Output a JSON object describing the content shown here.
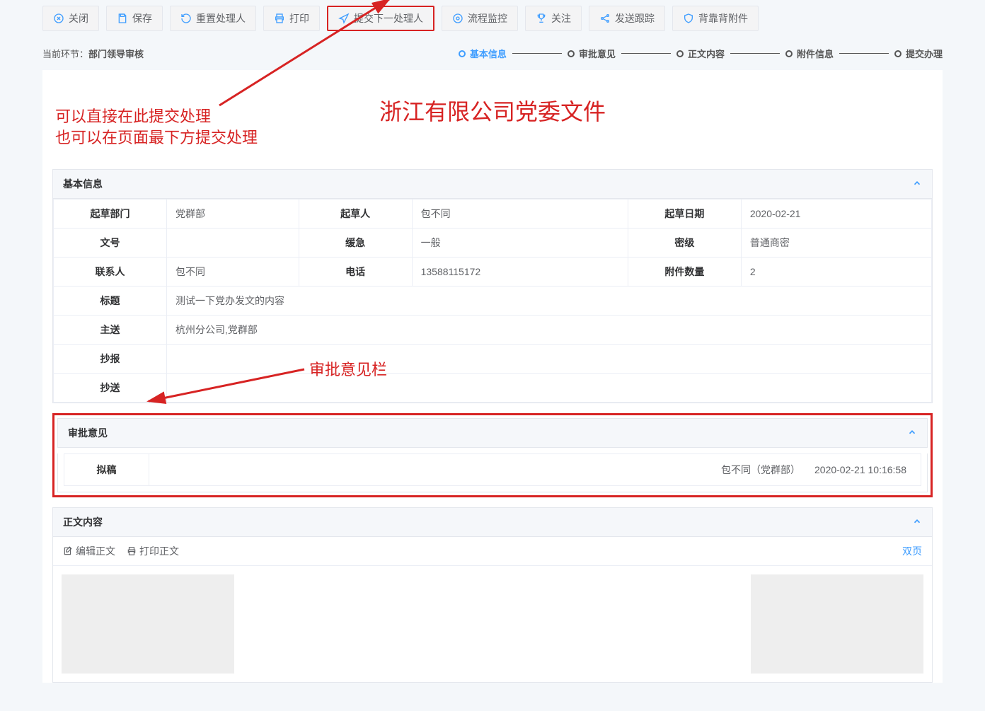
{
  "toolbar": {
    "close": "关闭",
    "save": "保存",
    "reset_handler": "重置处理人",
    "print": "打印",
    "submit_next": "提交下一处理人",
    "flow_monitor": "流程监控",
    "follow": "关注",
    "send_track": "发送跟踪",
    "back_to_back_attach": "背靠背附件"
  },
  "subheader": {
    "stage_label": "当前环节：",
    "stage_value": "部门领导审核"
  },
  "breadcrumb": [
    {
      "label": "基本信息",
      "active": true
    },
    {
      "label": "审批意见",
      "active": false
    },
    {
      "label": "正文内容",
      "active": false
    },
    {
      "label": "附件信息",
      "active": false
    },
    {
      "label": "提交办理",
      "active": false
    }
  ],
  "annotations": {
    "line1": "可以直接在此提交处理",
    "line2": "也可以在页面最下方提交处理",
    "approval_col": "审批意见栏"
  },
  "doc_title": "浙江有限公司党委文件",
  "panels": {
    "basic": {
      "title": "基本信息",
      "rows": {
        "dept_label": "起草部门",
        "dept_value": "党群部",
        "drafter_label": "起草人",
        "drafter_value": "包不同",
        "date_label": "起草日期",
        "date_value": "2020-02-21",
        "docno_label": "文号",
        "docno_value": "",
        "urgency_label": "缓急",
        "urgency_value": "一般",
        "secret_label": "密级",
        "secret_value": "普通商密",
        "contact_label": "联系人",
        "contact_value": "包不同",
        "phone_label": "电话",
        "phone_value": "13588115172",
        "attach_label": "附件数量",
        "attach_value": "2",
        "title_label": "标题",
        "title_value": "测试一下党办发文的内容",
        "mainsend_label": "主送",
        "mainsend_value": "杭州分公司,党群部",
        "cc_label": "抄报",
        "cc_value": "",
        "cc2_label": "抄送",
        "cc2_value": ""
      }
    },
    "approval": {
      "title": "审批意见",
      "row": {
        "label": "拟稿",
        "person": "包不同（党群部）",
        "timestamp": "2020-02-21 10:16:58"
      }
    },
    "content": {
      "title": "正文内容",
      "edit": "编辑正文",
      "print": "打印正文",
      "dual": "双页"
    }
  }
}
